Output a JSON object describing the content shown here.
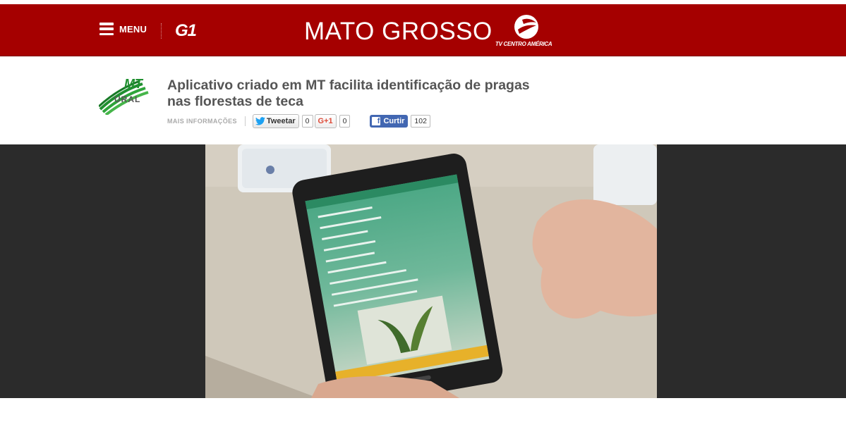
{
  "header": {
    "menu_label": "MENU",
    "site_logo": "G1",
    "region_title": "MATO GROSSO",
    "affiliate_name": "TV CENTRO AMÉRICA",
    "background_color": "#a50000"
  },
  "article": {
    "program_logo_text": "MT RURAL",
    "title": "Aplicativo criado em MT facilita identificação de pragas nas florestas de teca",
    "more_info_label": "MAIS INFORMAÇÕES",
    "tweet_label": "Tweetar",
    "tweet_count": "0",
    "gplus_label": "G+1",
    "gplus_count": "0",
    "facebook_label": "Curtir",
    "facebook_count": "102"
  },
  "video": {
    "description_icon": "video-frame-tablet-app"
  }
}
